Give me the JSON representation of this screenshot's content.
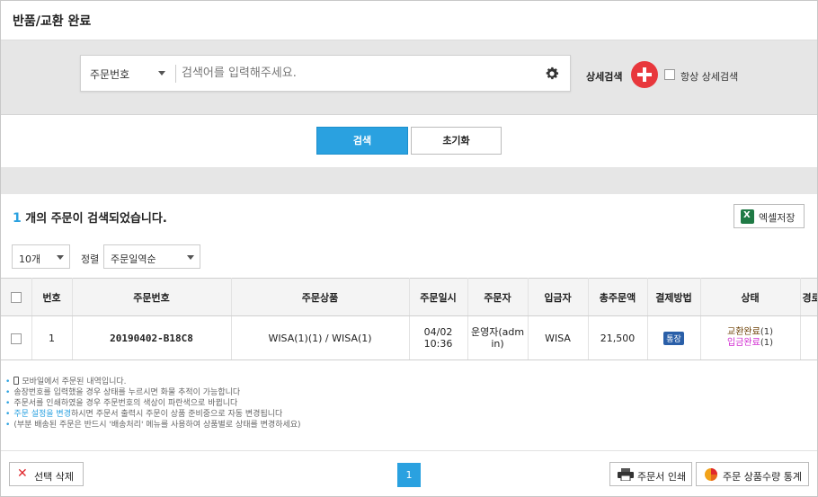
{
  "page": {
    "title": "반품/교환 완료"
  },
  "search": {
    "type_selected": "주문번호",
    "placeholder": "검색어를 입력해주세요.",
    "value": "",
    "detail_label": "상세검색",
    "always_detail_label": "항상 상세검색",
    "search_button": "검색",
    "reset_button": "초기화"
  },
  "result": {
    "count": "1",
    "text": " 개의 주문이 검색되었습니다.",
    "excel_button": "엑셀저장"
  },
  "controls": {
    "page_size": "10개",
    "sort_label": "정렬",
    "sort_selected": "주문일역순"
  },
  "table": {
    "headers": [
      "번호",
      "주문번호",
      "주문상품",
      "주문일시",
      "주문자",
      "입금자",
      "총주문액",
      "결제방법",
      "상태",
      "경로"
    ],
    "rows": [
      {
        "no": "1",
        "order_no": "20190402-B18C8",
        "product": "WISA(1)(1) / WISA(1)",
        "order_date": "04/02 10:36",
        "orderer": "운영자(admin)",
        "payer": "WISA",
        "total": "21,500",
        "payment": "통장",
        "status1": "교환완료",
        "status1_count": "(1)",
        "status2": "입금완료",
        "status2_count": "(1)",
        "route": ""
      }
    ]
  },
  "notes": {
    "n1": "모바일에서 주문된 내역입니다.",
    "n2": "송장번호를 입력했을 경우 상태를 누르시면 화물 추적이 가능합니다",
    "n3": "주문서를 인쇄하였을 경우 주문번호의 색상이 파란색으로 바뀝니다",
    "n4_link": "주문 설정을 변경",
    "n4_rest": "하시면 주문서 출력시 주문이 상품 준비중으로 자동 변경됩니다",
    "n5": "(부분 배송된 주문은 반드시 '배송처리' 메뉴를 사용하여 상품별로 상태를 변경하세요)"
  },
  "footer": {
    "delete_button": "선택 삭제",
    "current_page": "1",
    "print_button": "주문서 인쇄",
    "stats_button": "주문 상품수량 통계"
  },
  "colors": {
    "accent": "#2aa1e0",
    "plus": "#e8373c",
    "payer": "#e07b25",
    "status_exchange": "#6a3d00",
    "status_paid": "#d12ad1",
    "badge": "#2a5fa8",
    "excel": "#1f7a45"
  },
  "icons": [
    "gear-icon",
    "plus-icon",
    "excel-icon",
    "mobile-icon",
    "close-icon",
    "printer-icon",
    "pie-chart-icon"
  ]
}
